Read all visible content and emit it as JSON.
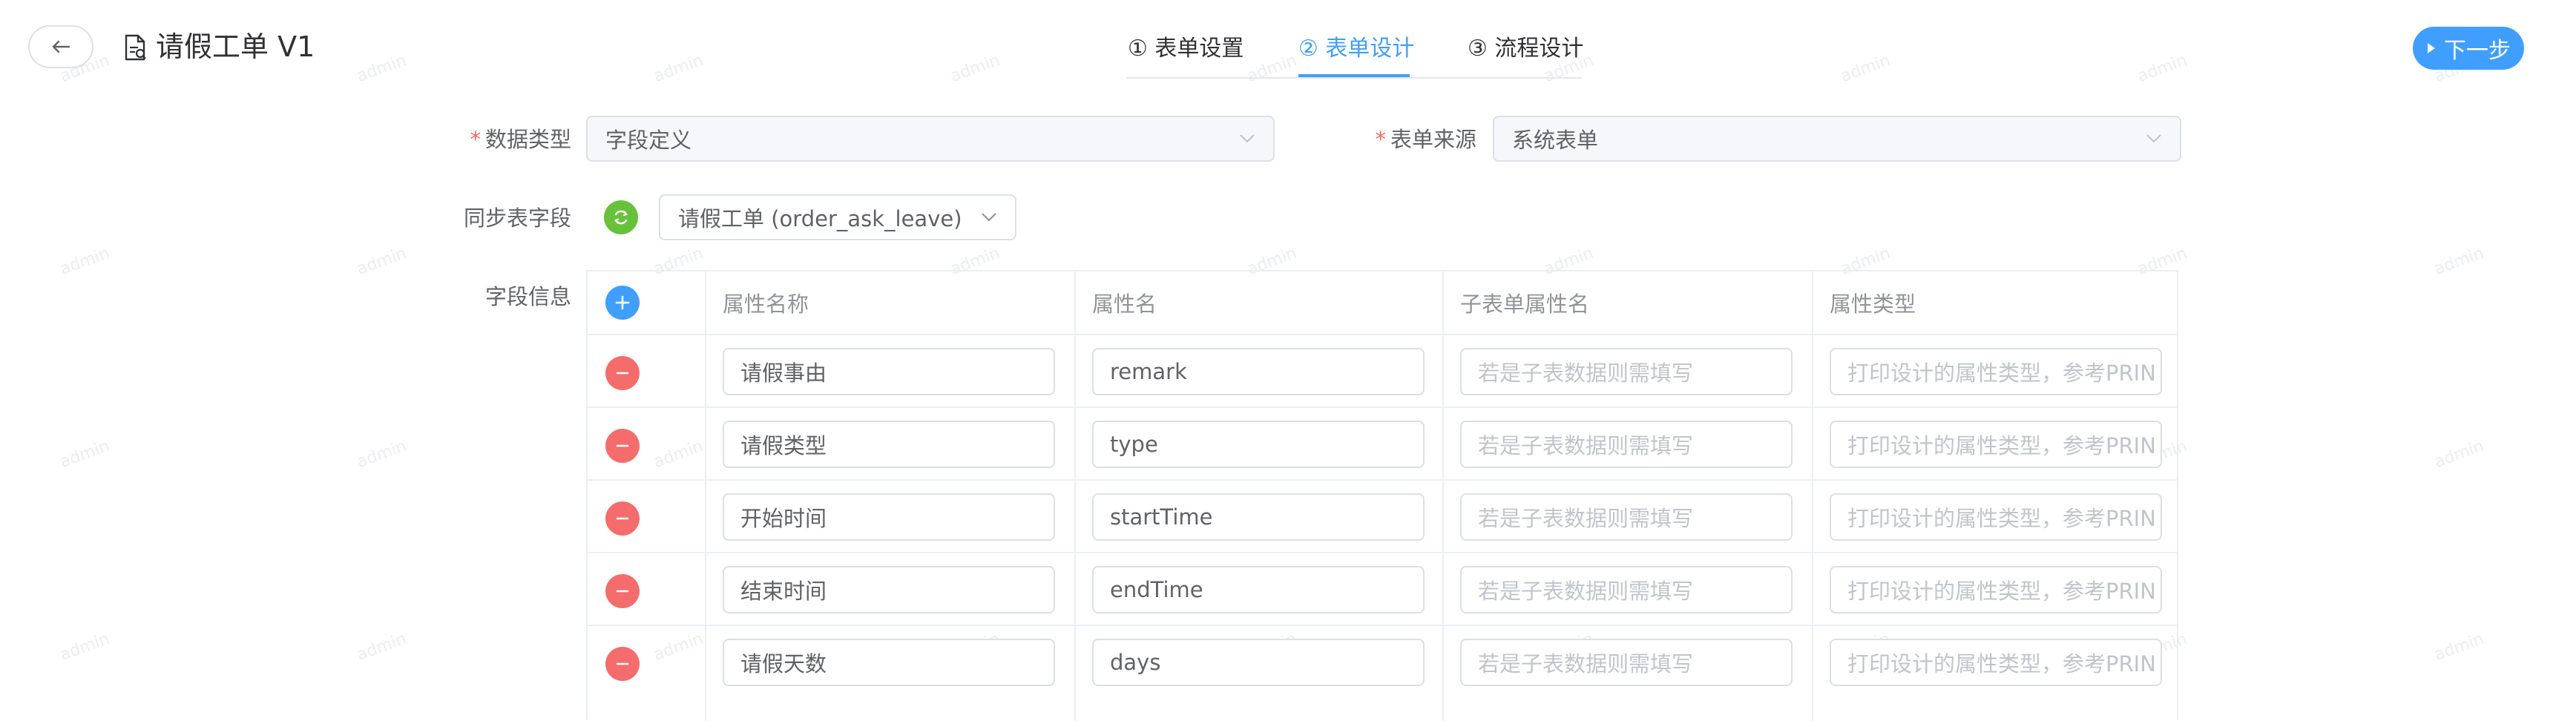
{
  "watermark": "admin",
  "header": {
    "title": "请假工单 V1",
    "back_icon": "arrow-left-icon",
    "doc_icon": "document-icon",
    "tabs": [
      {
        "label": "① 表单设置",
        "active": false
      },
      {
        "label": "② 表单设计",
        "active": true
      },
      {
        "label": "③ 流程设计",
        "active": false
      }
    ],
    "next_button": "下一步",
    "accent_color": "#409eff"
  },
  "form": {
    "data_type": {
      "required_mark": "*",
      "label": "数据类型",
      "value": "字段定义"
    },
    "form_source": {
      "required_mark": "*",
      "label": "表单来源",
      "value": "系统表单"
    },
    "sync": {
      "label": "同步表字段",
      "value": "请假工单 (order_ask_leave)"
    },
    "fields_label": "字段信息"
  },
  "table": {
    "columns": [
      "属性名称",
      "属性名",
      "子表单属性名",
      "属性类型"
    ],
    "sub_placeholder": "若是子表数据则需填写",
    "type_placeholder": "打印设计的属性类型，参考PRIN",
    "rows": [
      {
        "display_name": "请假事由",
        "name": "remark"
      },
      {
        "display_name": "请假类型",
        "name": "type"
      },
      {
        "display_name": "开始时间",
        "name": "startTime"
      },
      {
        "display_name": "结束时间",
        "name": "endTime"
      },
      {
        "display_name": "请假天数",
        "name": "days"
      }
    ],
    "status_colors": {
      "add": "#409eff",
      "delete": "#f56c6c",
      "sync": "#67c23a"
    }
  }
}
